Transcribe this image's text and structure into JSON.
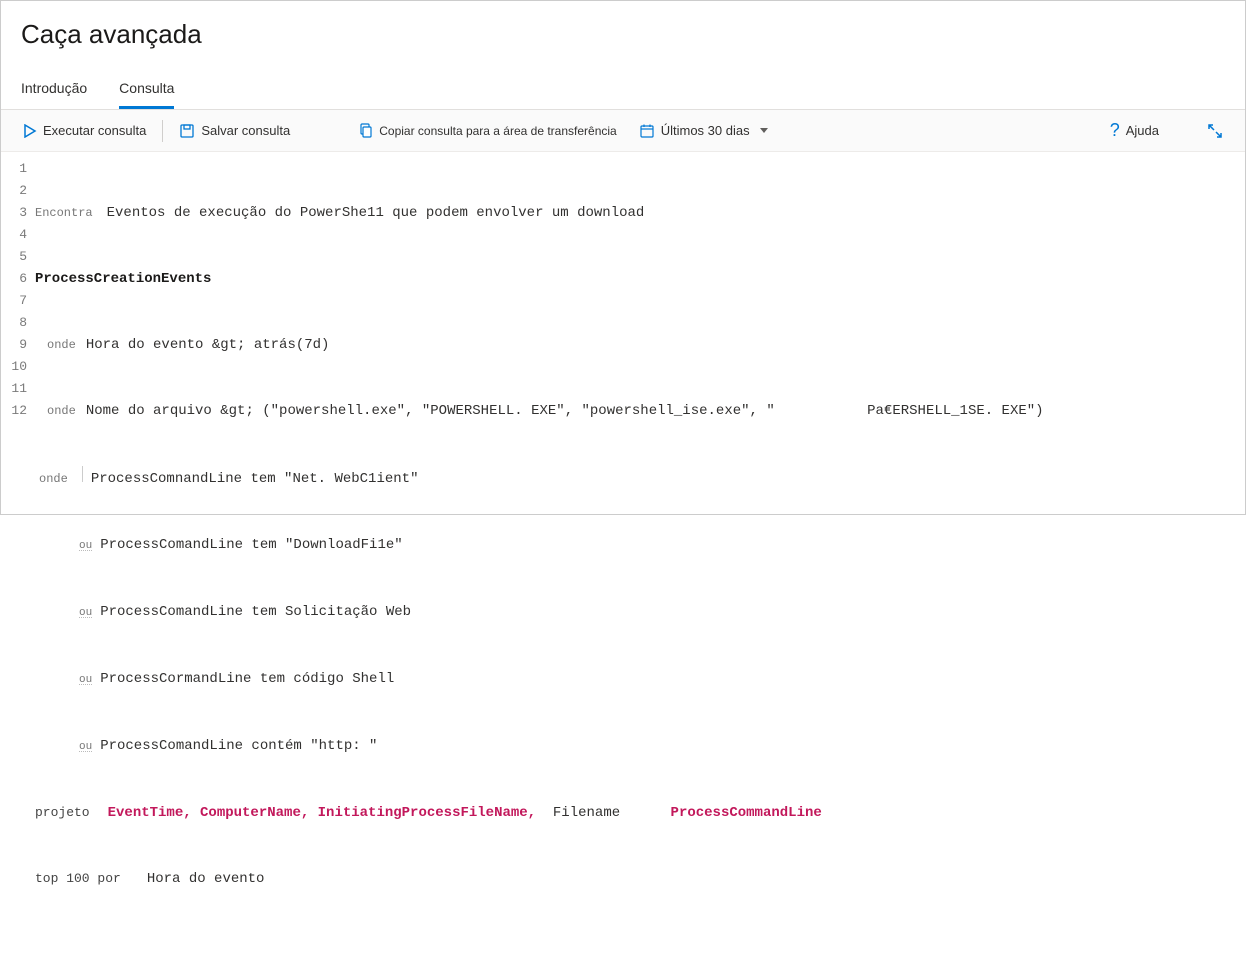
{
  "header": {
    "title": "Caça avançada"
  },
  "tabs": {
    "intro": "Introdução",
    "query": "Consulta"
  },
  "toolbar": {
    "run": "Executar consulta",
    "save": "Salvar consulta",
    "copy": "Copiar consulta para a área de transferência",
    "range": "Últimos 30 dias",
    "help": "Ajuda"
  },
  "editor": {
    "lines": [
      "1",
      "2",
      "3",
      "4",
      "5",
      "6",
      "7",
      "8",
      "9",
      "10",
      "11",
      "12"
    ],
    "l1_label": "Encontra",
    "l1_text": "Eventos de execução do PowerShe11 que podem envolver um download",
    "l2": "ProcessCreationEvents",
    "l3_label": "onde",
    "l3_text": "Hora do evento &gt; atrás(7d)",
    "l4_label": "onde",
    "l4_text": "Nome do arquivo &gt; (\"powershell.exe\", \"POWERSHELL. EXE\", \"powershell_ise.exe\", \"           Pa€ERSHELL_1SE. EXE\")",
    "l5_label": "onde",
    "l5_text": "ProcessComnandLine tem \"Net. WebC1ient\"",
    "l6_label": "ou",
    "l6_text": "ProcessComandLine tem \"DownloadFi1e\"",
    "l7_label": "ou",
    "l7_text": "ProcessComandLine tem Solicitação Web",
    "l8_label": "ou",
    "l8_text": "ProcessCormandLine tem código Shell",
    "l9_label": "ou",
    "l9_text": "ProcessComandLine contém \"http: \"",
    "l10_label": "projeto",
    "l10_a": "EventTime, ComputerName, InitiatingProcessFileName,",
    "l10_b": "Filename",
    "l10_c": "ProcessCommandLine",
    "l11_a": "top 100 por",
    "l11_b": "Hora do evento"
  }
}
